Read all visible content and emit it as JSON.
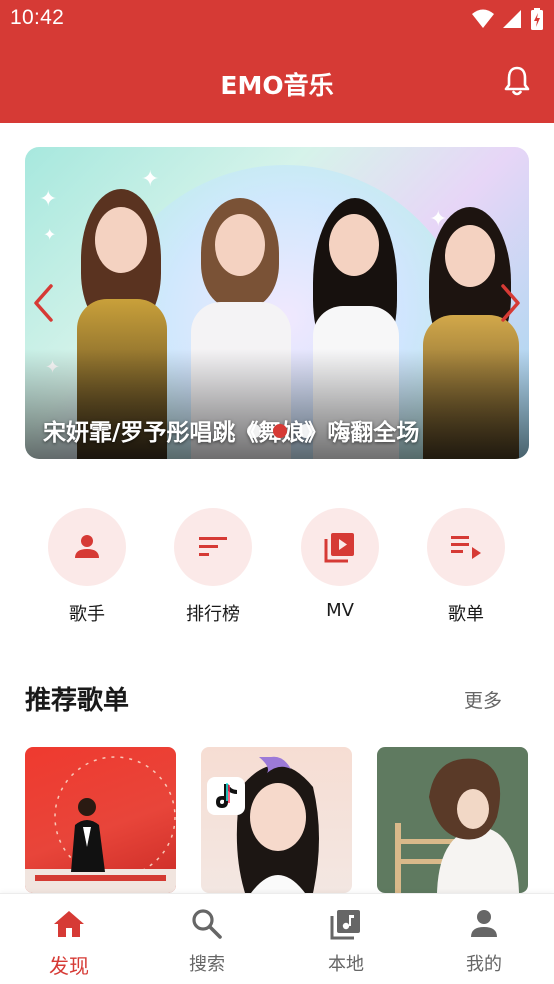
{
  "status_bar": {
    "time": "10:42"
  },
  "app_bar": {
    "title": "EMO音乐",
    "icon": "bell-icon"
  },
  "banner": {
    "caption": "宋妍霏/罗予彤唱跳《舞娘》嗨翻全场",
    "dots_total": 3,
    "active_dot": 2
  },
  "quick_entries": [
    {
      "label": "歌手",
      "icon": "person-icon"
    },
    {
      "label": "排行榜",
      "icon": "sort-lines-icon"
    },
    {
      "label": "MV",
      "icon": "video-library-icon"
    },
    {
      "label": "歌单",
      "icon": "playlist-play-icon"
    }
  ],
  "recommend": {
    "title": "推荐歌单",
    "more": "更多"
  },
  "bottom_nav": [
    {
      "label": "发现",
      "icon": "home-icon",
      "active": true
    },
    {
      "label": "搜索",
      "icon": "search-icon",
      "active": false
    },
    {
      "label": "本地",
      "icon": "music-library-icon",
      "active": false
    },
    {
      "label": "我的",
      "icon": "account-icon",
      "active": false
    }
  ],
  "colors": {
    "primary": "#d63a35",
    "quick_bg": "#fbe9e8",
    "inactive": "#666666"
  }
}
